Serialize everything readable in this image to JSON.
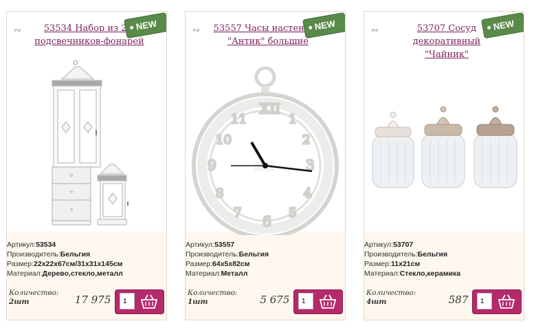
{
  "products": [
    {
      "title": "53534 Набор из 2-х подсвечников-фонарей",
      "badge": "NEW",
      "specs": [
        {
          "label": "Артикул:",
          "value": "53534"
        },
        {
          "label": "Производитель:",
          "value": "Бельгия"
        },
        {
          "label": "Размер:",
          "value": "22x22x67см/31x31x145см"
        },
        {
          "label": "Материал:",
          "value": "Дерево,стекло,металл"
        }
      ],
      "quantity_label": "Количество:",
      "quantity_value": "2шт",
      "price": "17 975 .-",
      "order_qty": "1",
      "image_icon": "lanterns-image"
    },
    {
      "title": "53557 Часы настенные \"Антик\" большие",
      "badge": "NEW",
      "specs": [
        {
          "label": "Артикул:",
          "value": "53557"
        },
        {
          "label": "Производитель:",
          "value": "Бельгия"
        },
        {
          "label": "Размер:",
          "value": "64x5x82см"
        },
        {
          "label": "Материал:",
          "value": "Металл"
        }
      ],
      "quantity_label": "Количество:",
      "quantity_value": "1шт",
      "price": "5 675 .-",
      "order_qty": "1",
      "image_icon": "clock-image"
    },
    {
      "title": "53707 Сосуд декоративный \"Чайник\"",
      "badge": "NEW",
      "specs": [
        {
          "label": "Артикул:",
          "value": "53707"
        },
        {
          "label": "Производитель:",
          "value": "Бельгия"
        },
        {
          "label": "Размер:",
          "value": "11x21см"
        },
        {
          "label": "Материал:",
          "value": "Стекло,керамика"
        }
      ],
      "quantity_label": "Количество:",
      "quantity_value": "4шт",
      "price": "587 .-",
      "order_qty": "1",
      "image_icon": "jars-image"
    }
  ],
  "colors": {
    "title": "#7a1f5b",
    "buy_button": "#b42a6b",
    "new_badge": "#5a8a4a",
    "card_bg": "#fdf7ef"
  }
}
